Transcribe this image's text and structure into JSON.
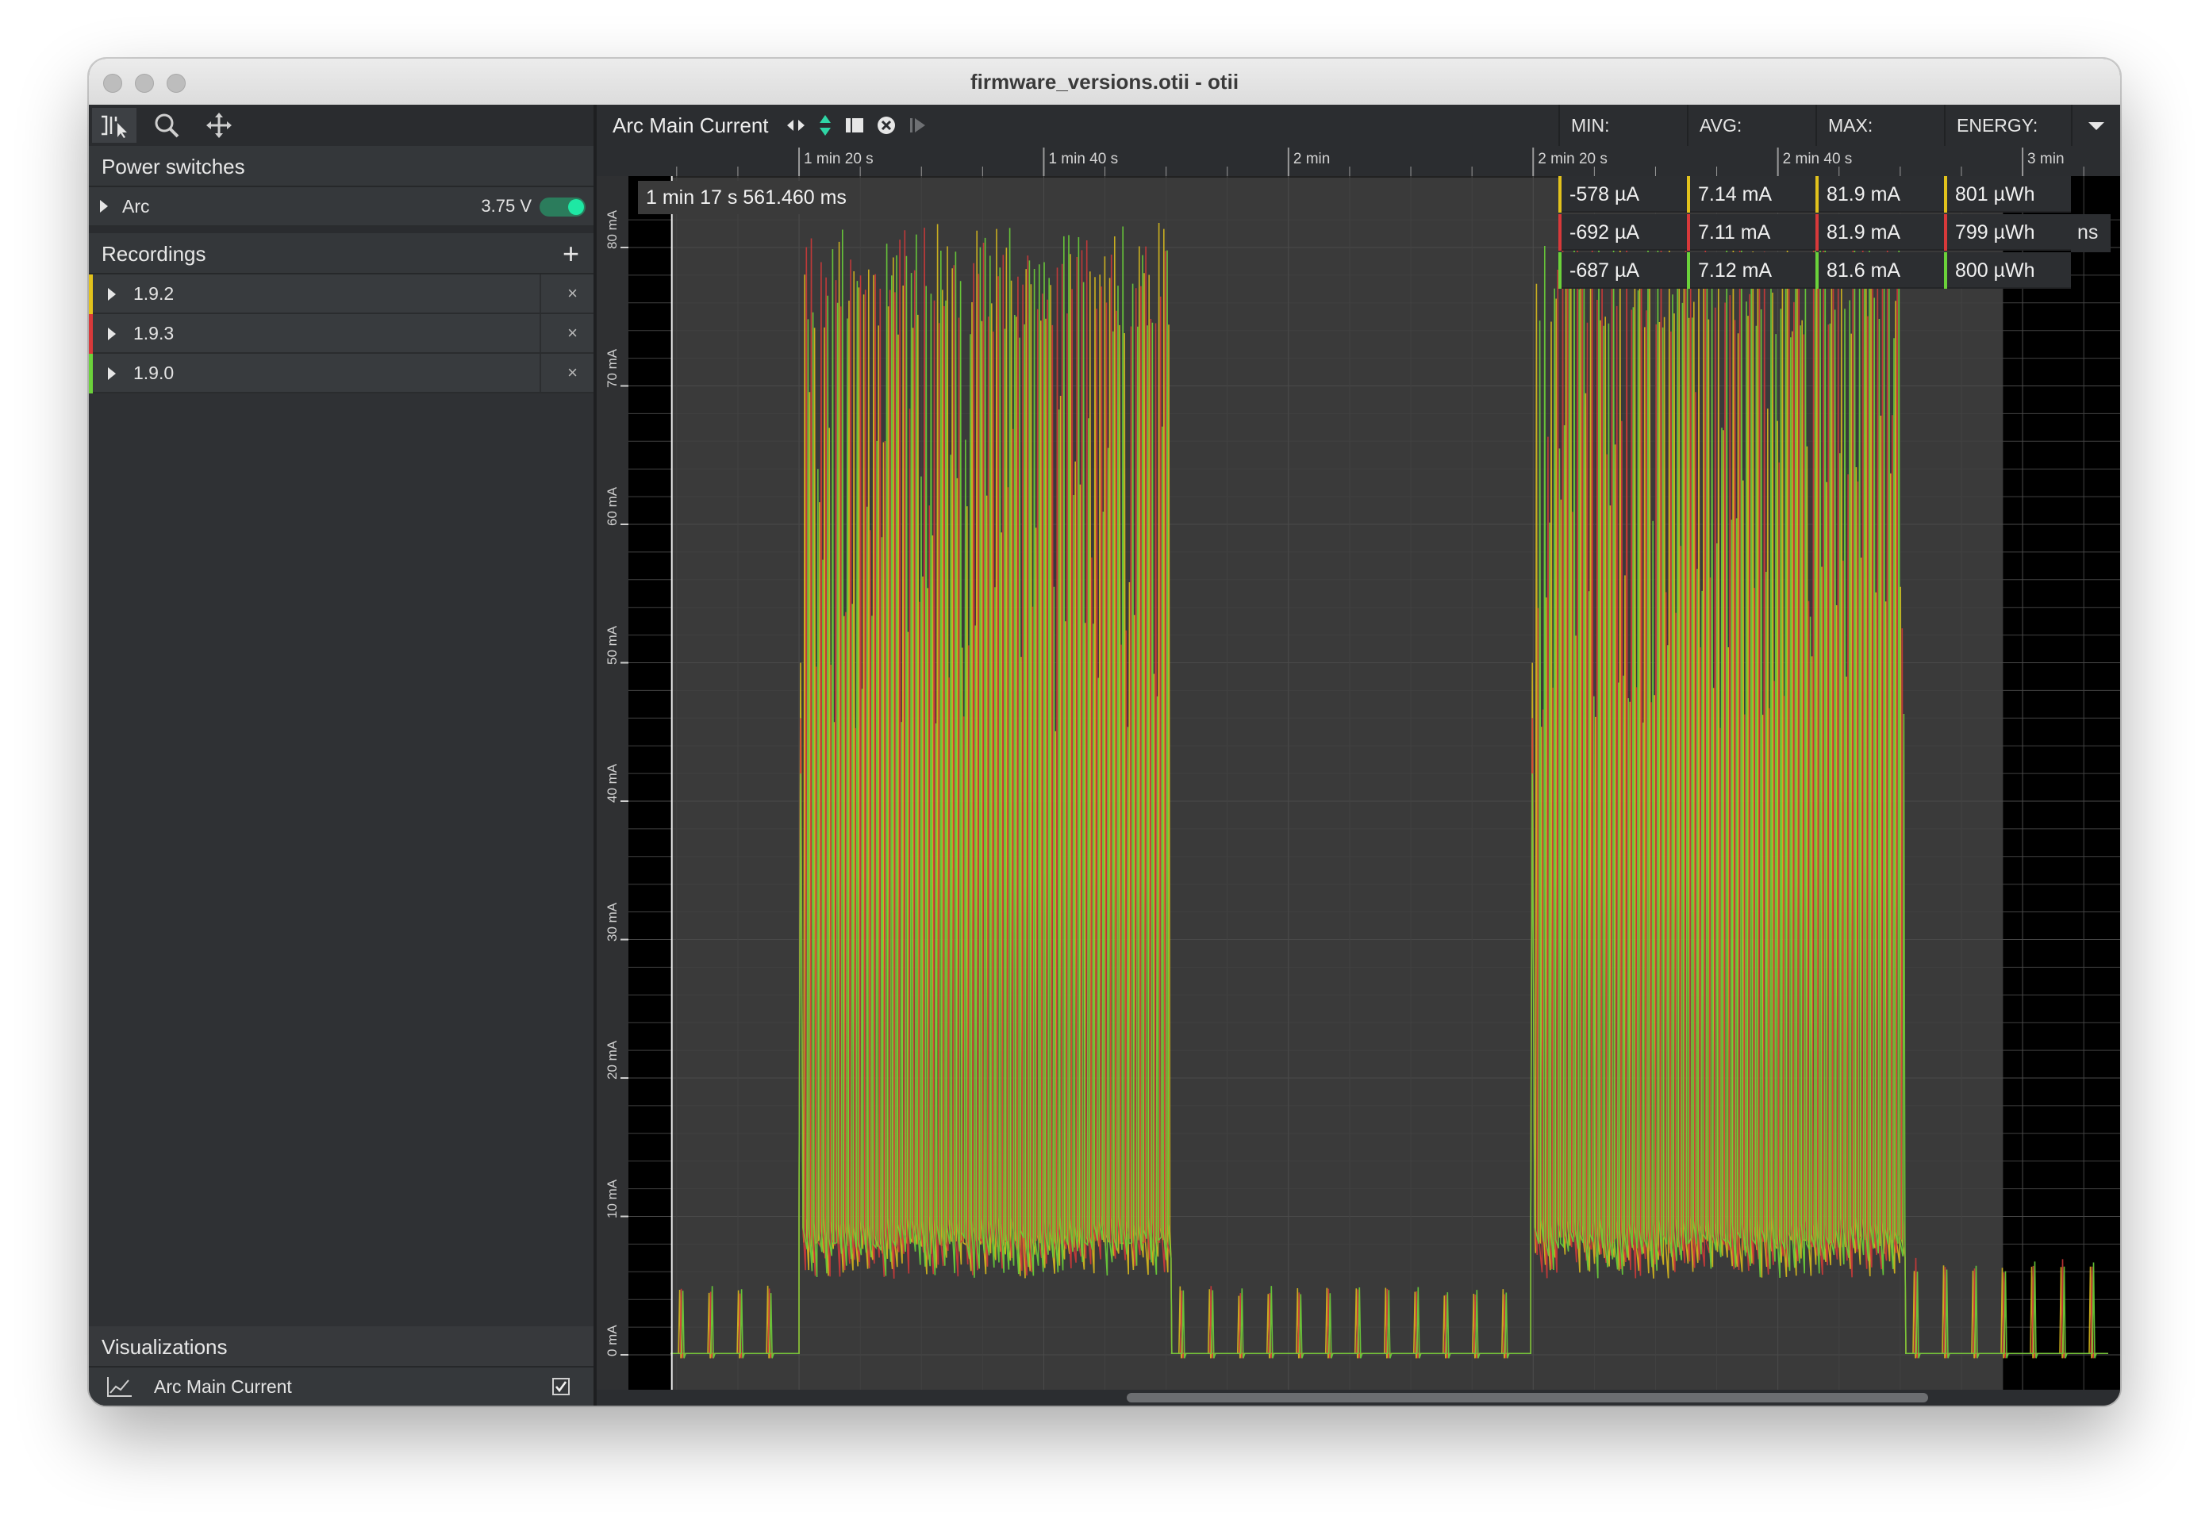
{
  "window": {
    "title": "firmware_versions.otii - otii"
  },
  "toolbar": {
    "tools": [
      {
        "name": "select-tool-icon",
        "active": true
      },
      {
        "name": "zoom-tool-icon",
        "active": false
      },
      {
        "name": "pan-tool-icon",
        "active": false
      }
    ]
  },
  "power_switches": {
    "header": "Power switches",
    "device": {
      "name": "Arc",
      "voltage": "3.75 V",
      "enabled": true
    }
  },
  "recordings": {
    "header": "Recordings",
    "items": [
      {
        "label": "1.9.2",
        "color": "#e2c21c"
      },
      {
        "label": "1.9.3",
        "color": "#d8393a"
      },
      {
        "label": "1.9.0",
        "color": "#6bd23a"
      }
    ]
  },
  "visualizations": {
    "header": "Visualizations",
    "items": [
      {
        "label": "Arc Main Current",
        "checked": true
      }
    ]
  },
  "chart": {
    "title": "Arc Main Current",
    "cursor_time": "1 min 17 s 561.460 ms",
    "x_ticks": [
      "1 min 20 s",
      "1 min 40 s",
      "2 min",
      "2 min 20 s",
      "2 min 40 s",
      "3 min"
    ],
    "y_ticks": [
      "0 mA",
      "10 mA",
      "20 mA",
      "30 mA",
      "40 mA",
      "50 mA",
      "60 mA",
      "70 mA",
      "80 mA"
    ],
    "partial_label": "ns"
  },
  "stats": {
    "headers": [
      "MIN:",
      "AVG:",
      "MAX:",
      "ENERGY:"
    ],
    "rows": [
      {
        "color": "#e2c21c",
        "min": "-578 µA",
        "avg": "7.14 mA",
        "max": "81.9 mA",
        "energy": "801 µWh"
      },
      {
        "color": "#d8393a",
        "min": "-692 µA",
        "avg": "7.11 mA",
        "max": "81.9 mA",
        "energy": "799 µWh"
      },
      {
        "color": "#6bd23a",
        "min": "-687 µA",
        "avg": "7.12 mA",
        "max": "81.6 mA",
        "energy": "800 µWh"
      }
    ]
  },
  "chart_data": {
    "type": "line",
    "title": "Arc Main Current",
    "xlabel": "",
    "ylabel": "",
    "x_unit": "s",
    "y_unit": "mA",
    "xlim": [
      68,
      187
    ],
    "ylim": [
      0,
      84
    ],
    "x_tick_values": [
      80,
      100,
      120,
      140,
      160,
      180
    ],
    "y_tick_values": [
      0,
      10,
      20,
      30,
      40,
      50,
      60,
      70,
      80
    ],
    "grid": true,
    "series": [
      {
        "name": "1.9.2",
        "color": "#e2c21c",
        "segments": [
          {
            "x_start": 69.5,
            "x_end": 80.0,
            "pattern": "periodic spikes",
            "baseline": 0.1,
            "peak": 5
          },
          {
            "x_start": 80.0,
            "x_end": 110.4,
            "pattern": "active burst",
            "baseline": 8,
            "peak": 81.9
          },
          {
            "x_start": 110.4,
            "x_end": 139.8,
            "pattern": "periodic spikes",
            "baseline": 0.1,
            "peak": 5
          },
          {
            "x_start": 139.8,
            "x_end": 170.4,
            "pattern": "active burst",
            "baseline": 8,
            "peak": 81.9
          },
          {
            "x_start": 170.4,
            "x_end": 187.0,
            "pattern": "periodic spikes",
            "baseline": 0.1,
            "peak": 7
          }
        ]
      },
      {
        "name": "1.9.3",
        "color": "#d8393a",
        "segments": [
          {
            "x_start": 69.5,
            "x_end": 80.0,
            "pattern": "periodic spikes",
            "baseline": 0.1,
            "peak": 5
          },
          {
            "x_start": 80.0,
            "x_end": 110.4,
            "pattern": "active burst",
            "baseline": 8,
            "peak": 81.9
          },
          {
            "x_start": 110.4,
            "x_end": 139.8,
            "pattern": "periodic spikes",
            "baseline": 0.1,
            "peak": 5
          },
          {
            "x_start": 139.8,
            "x_end": 170.4,
            "pattern": "active burst",
            "baseline": 8,
            "peak": 81.9
          },
          {
            "x_start": 170.4,
            "x_end": 187.0,
            "pattern": "periodic spikes",
            "baseline": 0.1,
            "peak": 7
          }
        ]
      },
      {
        "name": "1.9.0",
        "color": "#6bd23a",
        "segments": [
          {
            "x_start": 69.5,
            "x_end": 80.0,
            "pattern": "periodic spikes",
            "baseline": 0.1,
            "peak": 5
          },
          {
            "x_start": 80.0,
            "x_end": 110.4,
            "pattern": "active burst",
            "baseline": 8,
            "peak": 81.6
          },
          {
            "x_start": 110.4,
            "x_end": 139.8,
            "pattern": "periodic spikes",
            "baseline": 0.1,
            "peak": 5
          },
          {
            "x_start": 139.8,
            "x_end": 170.4,
            "pattern": "active burst",
            "baseline": 8,
            "peak": 81.6
          },
          {
            "x_start": 170.4,
            "x_end": 187.0,
            "pattern": "periodic spikes",
            "baseline": 0.1,
            "peak": 7
          }
        ]
      }
    ],
    "recording_range": [
      69.6,
      178.4
    ]
  }
}
